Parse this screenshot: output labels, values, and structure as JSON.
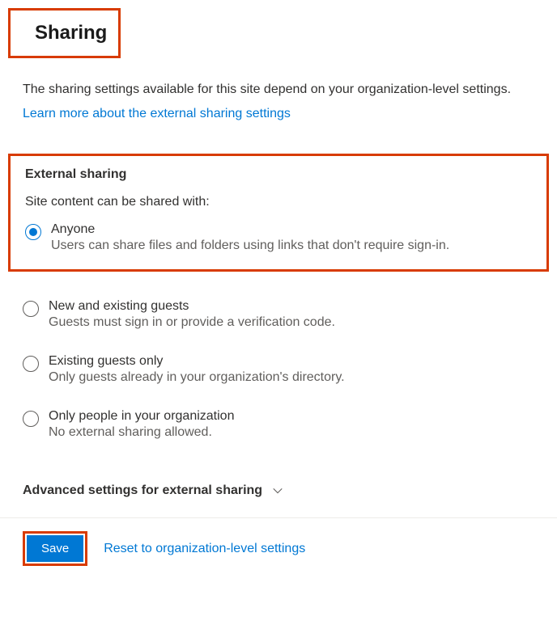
{
  "header": {
    "title": "Sharing"
  },
  "intro": {
    "text": "The sharing settings available for this site depend on your organization-level settings.",
    "link_label": "Learn more about the external sharing settings"
  },
  "external_sharing": {
    "heading": "External sharing",
    "subtext": "Site content can be shared with:",
    "options": [
      {
        "label": "Anyone",
        "description": "Users can share files and folders using links that don't require sign-in.",
        "selected": true
      },
      {
        "label": "New and existing guests",
        "description": "Guests must sign in or provide a verification code.",
        "selected": false
      },
      {
        "label": "Existing guests only",
        "description": "Only guests already in your organization's directory.",
        "selected": false
      },
      {
        "label": "Only people in your organization",
        "description": "No external sharing allowed.",
        "selected": false
      }
    ]
  },
  "advanced": {
    "label": "Advanced settings for external sharing"
  },
  "footer": {
    "save_label": "Save",
    "reset_label": "Reset to organization-level settings"
  }
}
